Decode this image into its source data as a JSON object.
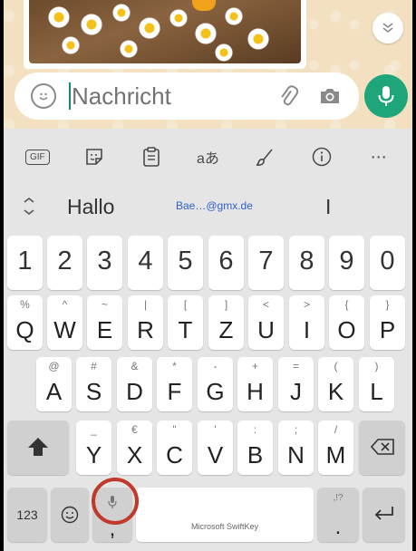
{
  "composer": {
    "placeholder": "Nachricht"
  },
  "keyboard": {
    "toolbar": [
      {
        "name": "gif-button",
        "label": "GIF"
      },
      {
        "name": "sticker-button"
      },
      {
        "name": "clipboard-button"
      },
      {
        "name": "translator-button",
        "label": "aあ"
      },
      {
        "name": "themes-button"
      },
      {
        "name": "info-button"
      },
      {
        "name": "more-button",
        "label": "⋯"
      }
    ],
    "suggestions": [
      "Hallo",
      "Bae…@gmx.de",
      "I"
    ],
    "digits": [
      "1",
      "2",
      "3",
      "4",
      "5",
      "6",
      "7",
      "8",
      "9",
      "0"
    ],
    "row_qwertz": [
      {
        "main": "Q",
        "sub": "%"
      },
      {
        "main": "W",
        "sub": "^"
      },
      {
        "main": "E",
        "sub": "~"
      },
      {
        "main": "R",
        "sub": "|"
      },
      {
        "main": "T",
        "sub": "["
      },
      {
        "main": "Z",
        "sub": "]"
      },
      {
        "main": "U",
        "sub": "<"
      },
      {
        "main": "I",
        "sub": ">"
      },
      {
        "main": "O",
        "sub": "{"
      },
      {
        "main": "P",
        "sub": "}"
      }
    ],
    "row_asdf": [
      {
        "main": "A",
        "sub": "@"
      },
      {
        "main": "S",
        "sub": "#"
      },
      {
        "main": "D",
        "sub": "&"
      },
      {
        "main": "F",
        "sub": "*"
      },
      {
        "main": "G",
        "sub": "-"
      },
      {
        "main": "H",
        "sub": "+"
      },
      {
        "main": "J",
        "sub": "="
      },
      {
        "main": "K",
        "sub": "("
      },
      {
        "main": "L",
        "sub": ")"
      }
    ],
    "row_yxcv": [
      {
        "main": "Y",
        "sub": "_"
      },
      {
        "main": "X",
        "sub": "€"
      },
      {
        "main": "C",
        "sub": "\""
      },
      {
        "main": "V",
        "sub": "'"
      },
      {
        "main": "B",
        "sub": ":"
      },
      {
        "main": "N",
        "sub": ";"
      },
      {
        "main": "M",
        "sub": "/"
      }
    ],
    "bottom": {
      "numbers_label": "123",
      "comma_label": ",",
      "space_label": "Microsoft SwiftKey",
      "period_label": ".",
      "period_sub": ",!?"
    }
  },
  "colors": {
    "accent_green": "#1ea67a",
    "highlight_circle": "#c0392b"
  }
}
